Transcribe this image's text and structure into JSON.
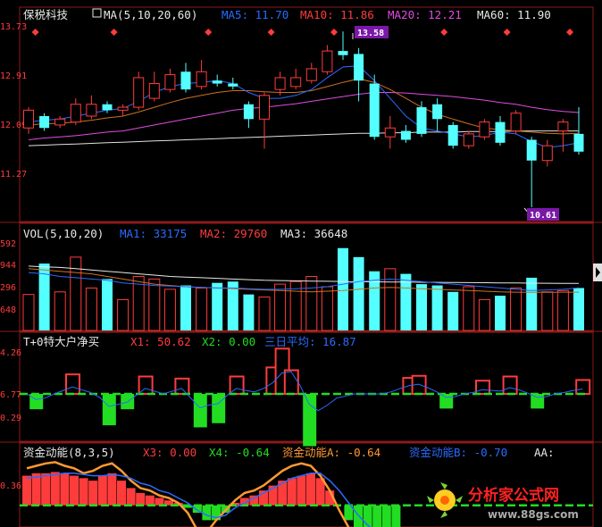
{
  "colors": {
    "bg": "#000000",
    "frame": "#8b1a1a",
    "grid": "#7a1010",
    "up": "#ff3c3c",
    "down": "#54ffff",
    "white": "#e8e8e8",
    "ma5": "#ffffff",
    "ma10": "#e0c000",
    "ma20": "#e04ce0",
    "ma60": "#e0e0e0",
    "blue": "#2a6bff",
    "green": "#22dd22",
    "yellow": "#ffdd33",
    "label_bg": "#7a18a8",
    "orange": "#ff9933"
  },
  "price_panel": {
    "title": "保税科技",
    "ma_params": "MA(5,10,20,60)",
    "ma5": "MA5: 11.70",
    "ma10": "MA10: 11.86",
    "ma20": "MA20: 12.21",
    "ma60": "MA60: 11.90",
    "y_ticks": [
      "13.73",
      "12.91",
      "12.09",
      "11.27"
    ],
    "high_label": "13.58",
    "low_label": "10.61"
  },
  "volume_panel": {
    "title": "VOL(5,10,20)",
    "ma1": "MA1: 33175",
    "ma2": "MA2: 29760",
    "ma3": "MA3: 36648",
    "y_ticks": [
      "592",
      "944",
      "296",
      "648"
    ]
  },
  "t0_panel": {
    "title": "T+0特大户净买",
    "x1": "X1: 50.62",
    "x2": "X2: 0.00",
    "avg": "三日平均: 16.87",
    "y_ticks": [
      "4.26",
      "6.77",
      "0.29"
    ]
  },
  "fund_panel": {
    "title": "资金动能(8,3,5)",
    "x3": "X3: 0.00",
    "x4": "X4: -0.64",
    "a": "资金动能A: -0.64",
    "b": "资金动能B: -0.70",
    "aa": "AA:",
    "y_ticks": [
      "0.36"
    ]
  },
  "watermark": {
    "title": "分析家公式网",
    "url": "www.88gs.com"
  },
  "chart_data": {
    "type": "candlestick",
    "candles": [
      [
        11.95,
        12.25,
        11.85,
        12.3
      ],
      [
        12.15,
        11.95,
        11.9,
        12.2
      ],
      [
        12.0,
        12.1,
        11.95,
        12.15
      ],
      [
        12.05,
        12.35,
        12.0,
        12.45
      ],
      [
        12.15,
        12.35,
        12.1,
        12.5
      ],
      [
        12.35,
        12.25,
        12.2,
        12.4
      ],
      [
        12.25,
        12.3,
        12.15,
        12.35
      ],
      [
        12.3,
        12.8,
        12.25,
        12.9
      ],
      [
        12.45,
        12.7,
        12.4,
        12.9
      ],
      [
        12.6,
        12.85,
        12.55,
        12.95
      ],
      [
        12.9,
        12.6,
        12.55,
        13.05
      ],
      [
        12.65,
        12.9,
        12.6,
        13.1
      ],
      [
        12.75,
        12.7,
        12.65,
        12.85
      ],
      [
        12.7,
        12.65,
        12.6,
        12.8
      ],
      [
        12.35,
        12.1,
        11.95,
        12.4
      ],
      [
        12.1,
        12.5,
        11.6,
        12.55
      ],
      [
        12.6,
        12.8,
        12.5,
        12.9
      ],
      [
        12.65,
        12.8,
        12.6,
        12.95
      ],
      [
        12.75,
        12.95,
        12.7,
        13.05
      ],
      [
        12.9,
        13.25,
        12.85,
        13.35
      ],
      [
        13.25,
        13.18,
        13.1,
        13.58
      ],
      [
        13.2,
        12.75,
        12.4,
        13.3
      ],
      [
        12.7,
        11.8,
        11.75,
        12.85
      ],
      [
        11.8,
        11.95,
        11.6,
        12.15
      ],
      [
        11.9,
        11.75,
        11.7,
        12.0
      ],
      [
        12.3,
        11.85,
        11.8,
        12.4
      ],
      [
        12.35,
        12.1,
        11.9,
        12.45
      ],
      [
        12.0,
        11.65,
        11.6,
        12.05
      ],
      [
        11.65,
        11.85,
        11.6,
        11.9
      ],
      [
        11.8,
        12.05,
        11.75,
        12.1
      ],
      [
        12.05,
        11.7,
        11.65,
        12.15
      ],
      [
        11.9,
        12.2,
        11.85,
        12.25
      ],
      [
        11.75,
        11.4,
        10.61,
        11.8
      ],
      [
        11.4,
        11.65,
        11.3,
        11.75
      ],
      [
        11.9,
        12.05,
        11.55,
        12.1
      ],
      [
        11.85,
        11.55,
        11.5,
        12.3
      ]
    ],
    "ma5_line": [
      12.05,
      12.08,
      12.1,
      12.15,
      12.2,
      12.25,
      12.28,
      12.4,
      12.55,
      12.65,
      12.7,
      12.72,
      12.75,
      12.7,
      12.55,
      12.45,
      12.45,
      12.5,
      12.6,
      12.8,
      12.98,
      13.0,
      12.75,
      12.45,
      12.15,
      11.95,
      11.9,
      11.85,
      11.8,
      11.82,
      11.88,
      11.85,
      11.72,
      11.62,
      11.65,
      11.7
    ],
    "ma10_line": [
      12.0,
      12.02,
      12.03,
      12.05,
      12.08,
      12.12,
      12.15,
      12.22,
      12.3,
      12.38,
      12.45,
      12.5,
      12.55,
      12.58,
      12.58,
      12.56,
      12.55,
      12.55,
      12.58,
      12.65,
      12.72,
      12.78,
      12.72,
      12.6,
      12.45,
      12.3,
      12.18,
      12.1,
      12.02,
      11.95,
      11.92,
      11.9,
      11.88,
      11.86,
      11.85,
      11.86
    ],
    "ma20_line": [
      11.75,
      11.78,
      11.8,
      11.82,
      11.85,
      11.88,
      11.9,
      11.95,
      12.0,
      12.05,
      12.1,
      12.15,
      12.2,
      12.25,
      12.28,
      12.3,
      12.33,
      12.36,
      12.4,
      12.44,
      12.48,
      12.52,
      12.55,
      12.55,
      12.54,
      12.52,
      12.5,
      12.48,
      12.45,
      12.42,
      12.38,
      12.35,
      12.3,
      12.26,
      12.23,
      12.21
    ],
    "ma60_line": [
      11.65,
      11.66,
      11.67,
      11.68,
      11.69,
      11.7,
      11.71,
      11.72,
      11.73,
      11.74,
      11.75,
      11.76,
      11.77,
      11.78,
      11.79,
      11.8,
      11.81,
      11.82,
      11.83,
      11.84,
      11.85,
      11.86,
      11.86,
      11.87,
      11.87,
      11.88,
      11.88,
      11.88,
      11.89,
      11.89,
      11.89,
      11.9,
      11.9,
      11.9,
      11.9,
      11.9
    ],
    "volume": [
      28000,
      52000,
      30000,
      57000,
      33000,
      40000,
      24000,
      42000,
      40000,
      32000,
      35000,
      33000,
      37000,
      38000,
      28000,
      26000,
      36000,
      38000,
      42000,
      34000,
      64000,
      57000,
      46000,
      48000,
      44000,
      36000,
      35000,
      30000,
      34000,
      24000,
      27000,
      33000,
      41000,
      30000,
      31000,
      33000
    ],
    "vol_ma1": [
      45000,
      44000,
      42000,
      41000,
      40000,
      39000,
      37000,
      36000,
      35000,
      34500,
      34000,
      33500,
      33000,
      33000,
      32500,
      32000,
      32000,
      32500,
      33000,
      34000,
      36000,
      38000,
      39000,
      40000,
      39000,
      38000,
      37000,
      36000,
      35000,
      34000,
      33000,
      32000,
      31000,
      31500,
      32000,
      33175
    ],
    "vol_ma2": [
      48000,
      47000,
      46000,
      45000,
      44000,
      42000,
      40000,
      38000,
      36000,
      35000,
      34000,
      33500,
      33000,
      32500,
      32000,
      31500,
      31000,
      30500,
      30000,
      30500,
      31000,
      32000,
      33000,
      33500,
      33000,
      32500,
      32000,
      31500,
      31000,
      30500,
      30000,
      29800,
      29600,
      29700,
      29750,
      29760
    ],
    "vol_ma3": [
      50000,
      49500,
      49000,
      48000,
      47000,
      46000,
      45000,
      44000,
      43000,
      42000,
      41500,
      41000,
      40500,
      40000,
      39500,
      39000,
      38800,
      38600,
      38400,
      38200,
      38000,
      37900,
      37800,
      37700,
      37600,
      37500,
      37400,
      37300,
      37200,
      37100,
      37000,
      36900,
      36800,
      36700,
      36650,
      36648
    ],
    "t0_bars": [
      0,
      -2.2,
      0,
      0,
      0,
      2.8,
      0,
      0,
      0,
      -4.5,
      0,
      -2.2,
      0,
      2.5,
      0,
      0,
      0,
      2.2,
      0,
      -4.8,
      0,
      -4.2,
      0,
      2.5,
      0,
      0,
      0,
      3.8,
      6.5,
      3.4,
      0,
      -7.5,
      0,
      0,
      0,
      0,
      0,
      0,
      0,
      0,
      0,
      0,
      2.3,
      2.6,
      0,
      0,
      -2.1,
      0,
      0,
      0,
      1.9,
      0,
      0,
      2.5,
      0,
      0,
      -2.1,
      0,
      0,
      0,
      0,
      2.0
    ],
    "t0_avg": [
      0,
      -0.8,
      -0.6,
      0,
      0.5,
      1.0,
      0.6,
      0.2,
      -0.5,
      -1.8,
      -1.5,
      -1.2,
      -0.2,
      0.8,
      0.4,
      0,
      0.4,
      0.8,
      -0.6,
      -2.0,
      -1.6,
      -1.4,
      -0.2,
      0.8,
      0.5,
      0.3,
      0.8,
      1.6,
      3.0,
      3.2,
      1.2,
      -1.5,
      -2.4,
      -1.6,
      -0.6,
      -0.3,
      0,
      0,
      0,
      0,
      0.3,
      0.8,
      1.2,
      1.4,
      0.9,
      0.3,
      -0.5,
      -0.4,
      0,
      0.2,
      0.6,
      0.5,
      0.4,
      0.9,
      0.6,
      0.1,
      -0.5,
      -0.4,
      0,
      0.2,
      0.5,
      0.7
    ],
    "fund_bars": [
      1.2,
      1.3,
      1.3,
      1.35,
      1.3,
      1.2,
      1.1,
      1.0,
      1.2,
      1.3,
      1.0,
      0.7,
      0.5,
      0.4,
      0.3,
      0.2,
      0.1,
      -0.1,
      -0.3,
      -0.6,
      -0.6,
      -0.3,
      0.1,
      0.3,
      0.4,
      0.6,
      0.8,
      1.0,
      1.1,
      1.2,
      1.3,
      1.1,
      0.6,
      0.0,
      -0.6,
      -1.0,
      -1.2,
      -1.3,
      -1.3,
      -1.2
    ],
    "fund_a": [
      1.5,
      1.6,
      1.7,
      1.75,
      1.6,
      1.5,
      1.3,
      1.4,
      1.6,
      1.7,
      1.4,
      1.0,
      0.7,
      0.6,
      0.4,
      0.3,
      0.1,
      -0.3,
      -1.0,
      -1.1,
      -0.6,
      -0.2,
      0.2,
      0.5,
      0.6,
      0.8,
      1.1,
      1.4,
      1.6,
      1.7,
      1.6,
      1.2,
      0.6,
      -0.2,
      -0.9,
      -1.3,
      -1.5,
      -1.6,
      -1.6,
      -1.5
    ],
    "fund_b": [
      1.1,
      1.15,
      1.2,
      1.25,
      1.3,
      1.3,
      1.25,
      1.2,
      1.2,
      1.25,
      1.2,
      1.1,
      0.9,
      0.8,
      0.6,
      0.5,
      0.3,
      0.1,
      -0.2,
      -0.4,
      -0.5,
      -0.4,
      -0.1,
      0.1,
      0.3,
      0.5,
      0.7,
      0.9,
      1.1,
      1.2,
      1.3,
      1.3,
      1.0,
      0.6,
      0.1,
      -0.4,
      -0.8,
      -1.1,
      -1.3,
      -1.4
    ],
    "fund_ylim": [
      -1.6,
      1.8
    ]
  }
}
